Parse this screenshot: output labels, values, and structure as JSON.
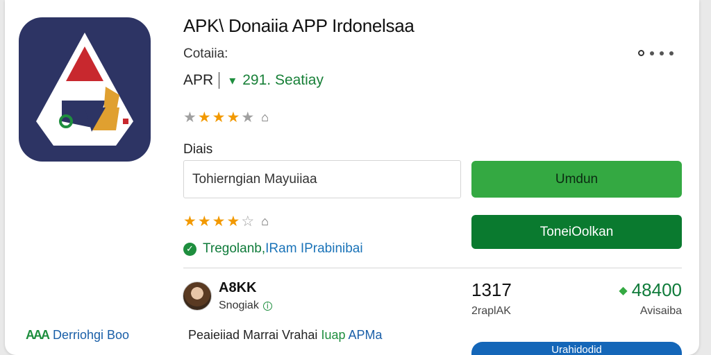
{
  "app": {
    "title": "APK\\ Donaiia APP Irdonelsaa",
    "subtitle": "Cotaiia:",
    "meta_label": "APR",
    "meta_value": "291. Seatiay",
    "section_label": "Diais",
    "input_value": "Tohierngian Mayuiiaa",
    "primary_button": "Umdun",
    "secondary_button": "ToneiOolkan",
    "verified_text_1": "Tregolanb,",
    "verified_text_2": " IRam IPrabinibai",
    "bottom_button": "Urahidodid"
  },
  "ratings": {
    "top_rating": 4,
    "bottom_rating": 4.5
  },
  "developer": {
    "name": "A8KK",
    "subtitle": "Snogiak"
  },
  "stats": [
    {
      "value": "1317",
      "label": "2raplAK"
    },
    {
      "value": "48400",
      "label": "Avisaiba"
    }
  ],
  "footer": {
    "left_mark": "AAA",
    "left_text": "Derriohgi Boo",
    "mid_text": "Peaieiiad Marrai Vrahai",
    "mid_highlight_1": " Iuap",
    "mid_highlight_2": " APMa"
  },
  "colors": {
    "icon_bg": "#2d3464",
    "primary_green": "#34a942",
    "dark_green": "#0a7a2f",
    "blue": "#1466b8",
    "star": "#f29900"
  }
}
